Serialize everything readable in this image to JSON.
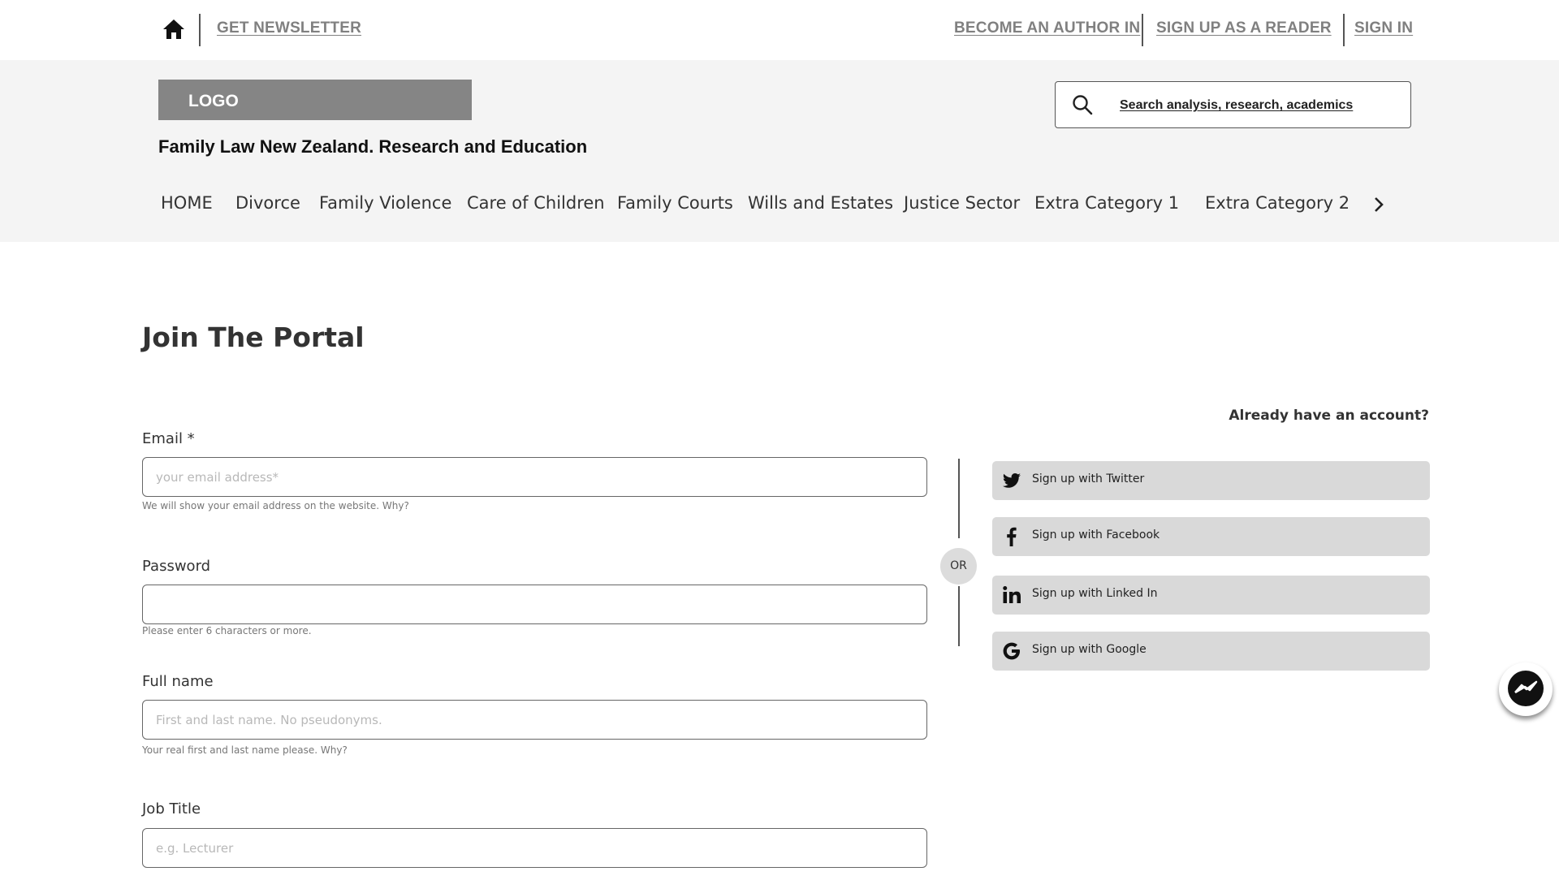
{
  "topbar": {
    "home_icon": "home-icon",
    "newsletter": "GET NEWSLETTER",
    "become_author": "BECOME AN AUTHOR IN",
    "sign_up_reader": "SIGN UP AS A READER",
    "sign_in": "SIGN IN"
  },
  "header": {
    "logo": "LOGO",
    "tagline": "Family Law New Zealand. Research and Education",
    "search": {
      "icon": "search-icon",
      "placeholder": "Search analysis, research, academics"
    },
    "nav": [
      "HOME",
      "Divorce",
      "Family Violence",
      "Care of Children",
      "Family Courts",
      "Wills and Estates",
      "Justice Sector",
      "Extra Category 1",
      "Extra Category 2"
    ],
    "nav_next_icon": "chevron-right-icon"
  },
  "main": {
    "title": "Join The Portal",
    "email": {
      "label": "Email *",
      "placeholder": "your email address*",
      "hint": "We will show your email address on the website. Why?"
    },
    "password": {
      "label": "Password",
      "placeholder": "",
      "hint": "Please enter 6 characters or more."
    },
    "full_name": {
      "label": "Full name",
      "placeholder": "First and last name. No pseudonyms.",
      "hint": "Your real first and last name please.  Why?"
    },
    "job_title": {
      "label": "Job Title",
      "placeholder": "e.g. Lecturer"
    },
    "or": "OR",
    "already": "Already have an account?",
    "social": [
      {
        "label": "Sign up with Twitter",
        "icon": "twitter-icon"
      },
      {
        "label": "Sign up with Facebook",
        "icon": "facebook-icon"
      },
      {
        "label": "Sign up with Linked In",
        "icon": "linkedin-icon"
      },
      {
        "label": "Sign up with Google",
        "icon": "google-icon"
      }
    ]
  },
  "messenger": {
    "icon": "messenger-icon"
  },
  "colors": {
    "header_bg": "#f4f4f4",
    "logo_bg": "#858585",
    "button_bg": "#d9d9d9",
    "link_gray": "#808080"
  }
}
